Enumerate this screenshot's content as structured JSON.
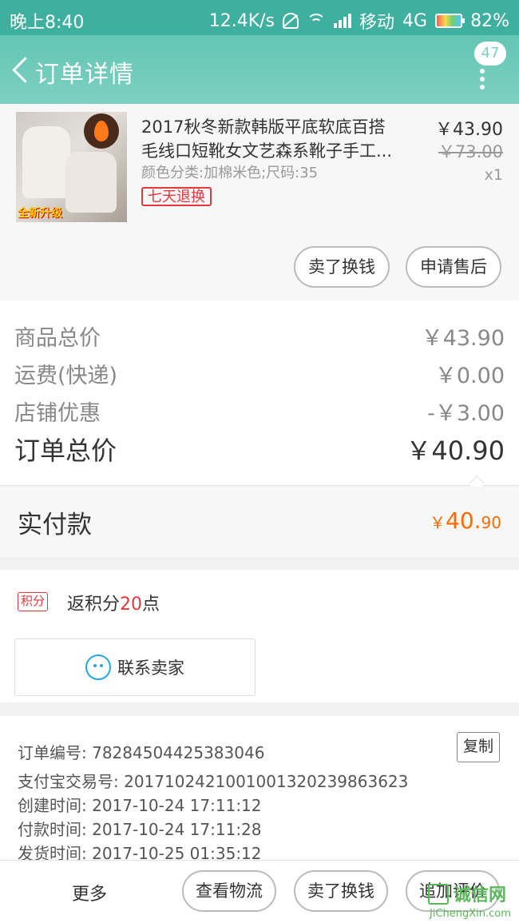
{
  "status_bar": {
    "time": "晚上8:40",
    "net_speed": "12.4K/s",
    "carrier": "移动",
    "network": "4G",
    "battery": "82%"
  },
  "header": {
    "title": "订单详情",
    "badge_count": "47"
  },
  "product": {
    "title_line1": "2017秋冬新款韩版平底软底百搭",
    "title_line2": "毛线口短靴女文艺森系靴子手工...",
    "spec": "颜色分类:加棉米色;尺码:35",
    "tag": "七天退换",
    "price": "￥43.90",
    "original_price": "￥73.00",
    "quantity": "x1",
    "image_badge": "全新升级",
    "buttons": {
      "sell": "卖了换钱",
      "after_sale": "申请售后"
    }
  },
  "summary": {
    "rows": [
      {
        "label": "商品总价",
        "value": "￥43.90"
      },
      {
        "label": "运费(快递)",
        "value": "￥0.00"
      },
      {
        "label": "店铺优惠",
        "value": "-￥3.00"
      }
    ],
    "total_label": "订单总价",
    "total_value": "￥40.90"
  },
  "paid": {
    "label": "实付款",
    "currency": "￥",
    "value_major": "40.",
    "value_minor": "90"
  },
  "points": {
    "tag": "积分",
    "text_prefix": "返积分",
    "count": "20",
    "text_suffix": "点",
    "contact_label": "联系卖家"
  },
  "order_info": {
    "order_no": "订单编号: 78284504425383046",
    "copy_label": "复制",
    "alipay_no": "支付宝交易号: 2017102421001001320239863623",
    "created": "创建时间: 2017-10-24 17:11:12",
    "paid": "付款时间: 2017-10-24 17:11:28",
    "shipped": "发货时间: 2017-10-25 01:35:12"
  },
  "bottom_bar": {
    "more": "更多",
    "logistics": "查看物流",
    "sell": "卖了换钱",
    "review": "追加评价"
  },
  "watermark": {
    "text": "诚信网",
    "url": "JiChengXin.com"
  },
  "colors": {
    "header": "#6fcbba",
    "accent_orange": "#ff6a00",
    "accent_red": "#e4393c"
  }
}
